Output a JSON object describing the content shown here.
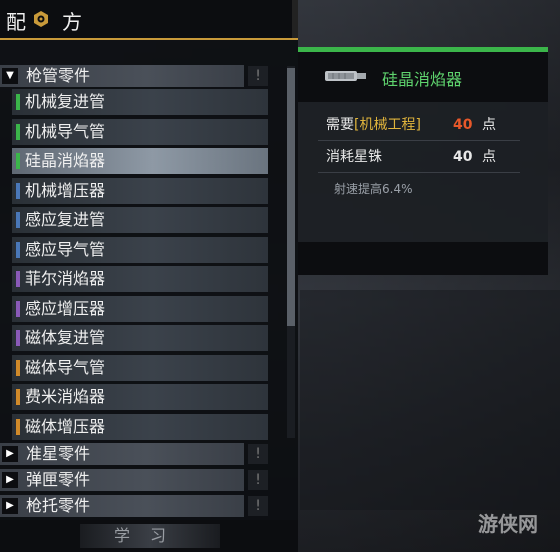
{
  "header": {
    "title_left": "配",
    "title_right": "方",
    "icon": "recipe-hex-icon"
  },
  "categories": [
    {
      "label": "枪管零件",
      "expanded": true,
      "marker": "!"
    },
    {
      "label": "准星零件",
      "expanded": false,
      "marker": "!"
    },
    {
      "label": "弹匣零件",
      "expanded": false,
      "marker": "!"
    },
    {
      "label": "枪托零件",
      "expanded": false,
      "marker": "!"
    }
  ],
  "items": [
    {
      "label": "机械复进管",
      "color": "#3bb54a"
    },
    {
      "label": "机械导气管",
      "color": "#3bb54a"
    },
    {
      "label": "硅晶消焰器",
      "color": "#3bb54a",
      "selected": true
    },
    {
      "label": "机械增压器",
      "color": "#4a78b8"
    },
    {
      "label": "感应复进管",
      "color": "#4a78b8"
    },
    {
      "label": "感应导气管",
      "color": "#4a78b8"
    },
    {
      "label": "菲尔消焰器",
      "color": "#8a5ab8"
    },
    {
      "label": "感应增压器",
      "color": "#8a5ab8"
    },
    {
      "label": "磁体复进管",
      "color": "#8a5ab8"
    },
    {
      "label": "磁体导气管",
      "color": "#d08a2a"
    },
    {
      "label": "费米消焰器",
      "color": "#d08a2a"
    },
    {
      "label": "磁体增压器",
      "color": "#d08a2a"
    }
  ],
  "bottom": {
    "learn_label": "学习"
  },
  "detail": {
    "title": "硅晶消焰器",
    "icon": "silencer-icon",
    "accent": "#3bb54a",
    "requirement": {
      "prefix": "需要",
      "tag": "[机械工程]",
      "value": "40",
      "unit": "点",
      "value_color": "#e8582a"
    },
    "cost": {
      "label": "消耗星铢",
      "value": "40",
      "unit": "点"
    },
    "note": "射速提高6.4%"
  },
  "watermark": "游侠网"
}
